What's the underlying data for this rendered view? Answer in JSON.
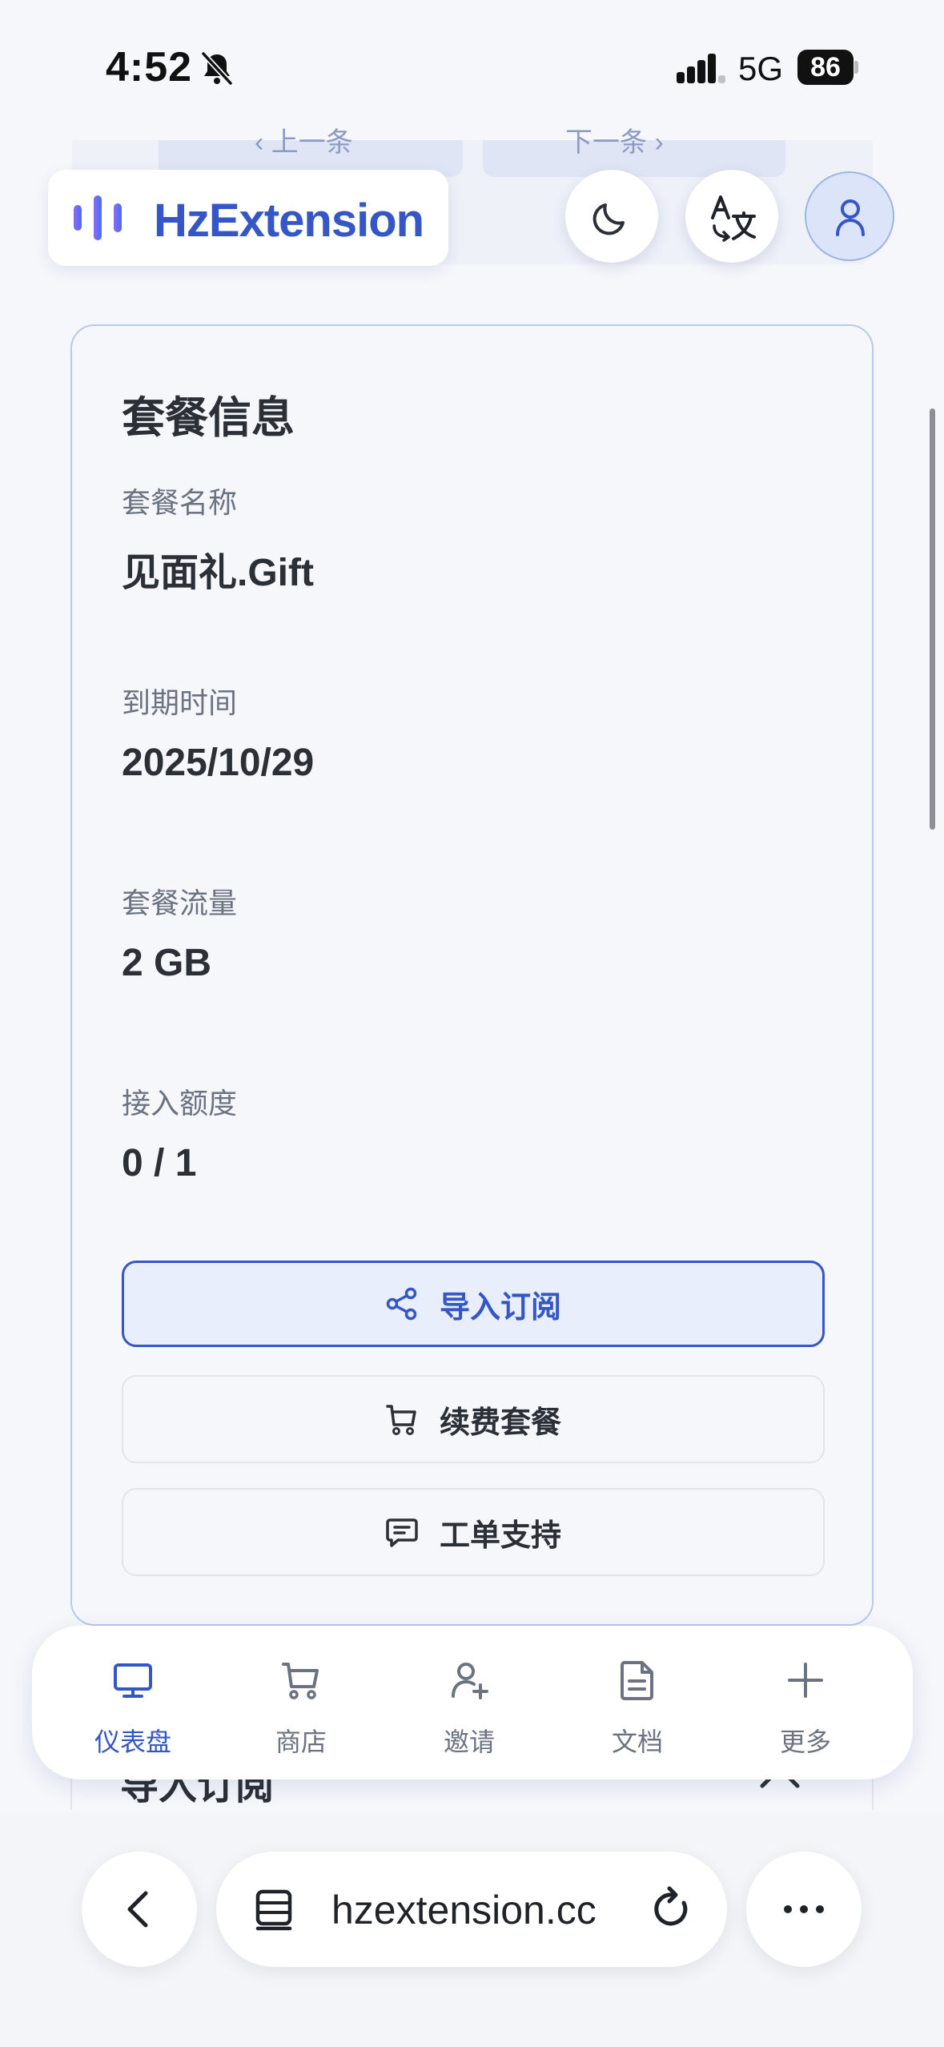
{
  "status_bar": {
    "time": "4:52",
    "network": "5G",
    "battery": "86",
    "bell_icon": "bell-slash-icon",
    "signal_icon": "cellular-signal-icon"
  },
  "pager": {
    "prev_label": "‹ 上一条",
    "next_label": "下一条 ›"
  },
  "header": {
    "brand": "HzExtension",
    "brand_color": "#3456c6",
    "theme_icon": "moon-icon",
    "language_icon": "translate-icon",
    "user_icon": "user-icon"
  },
  "plan_card": {
    "title": "套餐信息",
    "fields": [
      {
        "label": "套餐名称",
        "value": "见面礼.Gift"
      },
      {
        "label": "到期时间",
        "value": "2025/10/29"
      },
      {
        "label": "套餐流量",
        "value": "2 GB"
      },
      {
        "label": "接入额度",
        "value": "0 / 1"
      }
    ],
    "actions": [
      {
        "label": "导入订阅",
        "icon": "share-icon"
      },
      {
        "label": "续费套餐",
        "icon": "cart-icon"
      },
      {
        "label": "工单支持",
        "icon": "message-icon"
      }
    ]
  },
  "peek_section": {
    "title": "导入订阅"
  },
  "tabbar": {
    "active_color": "#3456c6",
    "items": [
      {
        "label": "仪表盘",
        "icon": "monitor-icon"
      },
      {
        "label": "商店",
        "icon": "cart-icon"
      },
      {
        "label": "邀请",
        "icon": "user-plus-icon"
      },
      {
        "label": "文档",
        "icon": "document-icon"
      },
      {
        "label": "更多",
        "icon": "plus-icon"
      }
    ]
  },
  "browser": {
    "url": "hzextension.cc",
    "back_icon": "chevron-left-icon",
    "page_icon": "page-menu-icon",
    "reload_icon": "reload-icon",
    "more_icon": "ellipsis-icon"
  }
}
